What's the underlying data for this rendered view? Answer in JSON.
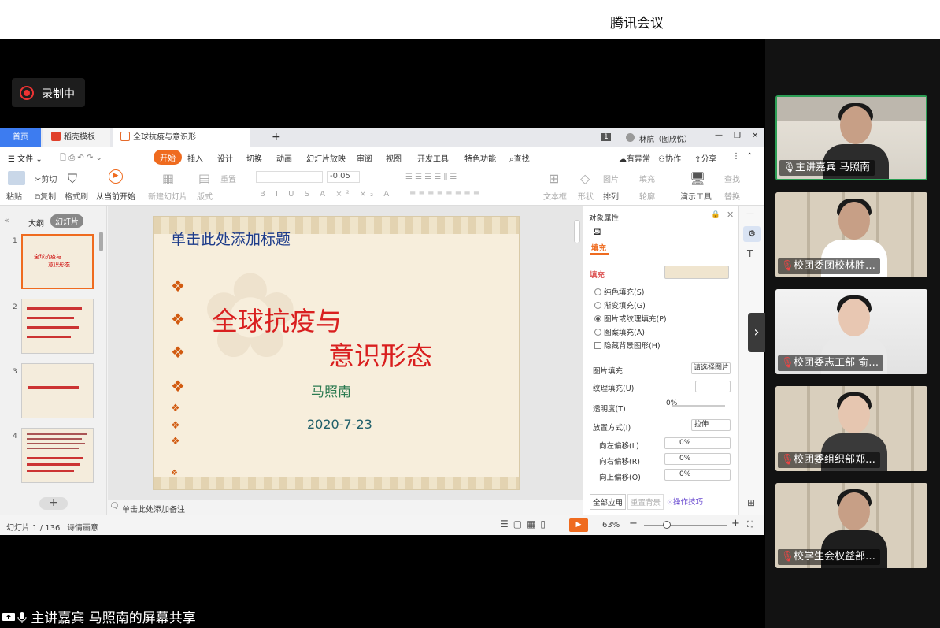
{
  "meeting": {
    "app_title": "腾讯会议",
    "recording_label": "录制中",
    "share_caption": "主讲嘉宾 马照南的屏幕共享"
  },
  "participants": [
    {
      "name": "主讲嘉宾 马照南",
      "mic": "on"
    },
    {
      "name": "校团委团校林胜…",
      "mic": "off"
    },
    {
      "name": "校团委志工部 俞…",
      "mic": "off"
    },
    {
      "name": "校团委组织部郑…",
      "mic": "off"
    },
    {
      "name": "校学生会权益部…",
      "mic": "off"
    }
  ],
  "wps": {
    "tabs": {
      "home": "首页",
      "template": "稻壳模板",
      "doc": "全球抗疫与意识形态.ppt",
      "user": "林航（图欣悦）",
      "page_badge": "1"
    },
    "menu": {
      "file": "文件",
      "start": "开始",
      "insert": "插入",
      "design": "设计",
      "transition": "切换",
      "animation": "动画",
      "slideshow": "幻灯片放映",
      "review": "审阅",
      "view": "视图",
      "dev": "开发工具",
      "special": "特色功能",
      "search": "查找",
      "unsaved": "有异常",
      "collab": "协作",
      "share": "分享"
    },
    "toolbar": {
      "paste": "粘贴",
      "cut": "剪切",
      "copy": "复制",
      "format": "格式刷",
      "from_current": "从当前开始",
      "new_slide": "新建幻灯片",
      "layout": "版式",
      "reset": "重置",
      "font_size": "-0.05",
      "textbox": "文本框",
      "shape": "形状",
      "arrange": "排列",
      "outline": "轮廓",
      "picture": "图片",
      "fill": "填充",
      "find": "查找",
      "replace": "替换",
      "drawing_tools": "演示工具"
    },
    "left_panel": {
      "outline_tab": "大纲",
      "slides_tab": "幻灯片",
      "nums": [
        "1",
        "2",
        "3",
        "4"
      ],
      "add": "+"
    },
    "slide": {
      "title_placeholder": "单击此处添加标题",
      "title_line1": "全球抗疫与",
      "title_line2": "意识形态",
      "author": "马照南",
      "date": "2020-7-23",
      "bullet": "❖"
    },
    "right_panel": {
      "header": "对象属性",
      "tab_fill": "填充",
      "section": "填充",
      "opt_solid": "纯色填充(S)",
      "opt_gradient": "渐变填充(G)",
      "opt_picture": "图片或纹理填充(P)",
      "opt_pattern": "图案填充(A)",
      "opt_hide": "隐藏背景图形(H)",
      "pic_fill": "图片填充",
      "pic_fill_val": "请选择图片",
      "texture_fill": "纹理填充(U)",
      "transparency": "透明度(T)",
      "transparency_val": "0%",
      "place": "放置方式(I)",
      "place_val": "拉伸",
      "off_left": "向左偏移(L)",
      "off_right": "向右偏移(R)",
      "off_up": "向上偏移(O)",
      "off_val": "0%",
      "apply_all": "全部应用",
      "reset_bg": "重置背景",
      "tips": "操作技巧"
    },
    "notes": "单击此处添加备注",
    "status": {
      "slide_count": "幻灯片 1 / 136",
      "theme": "诗情画意",
      "zoom": "63%"
    }
  }
}
